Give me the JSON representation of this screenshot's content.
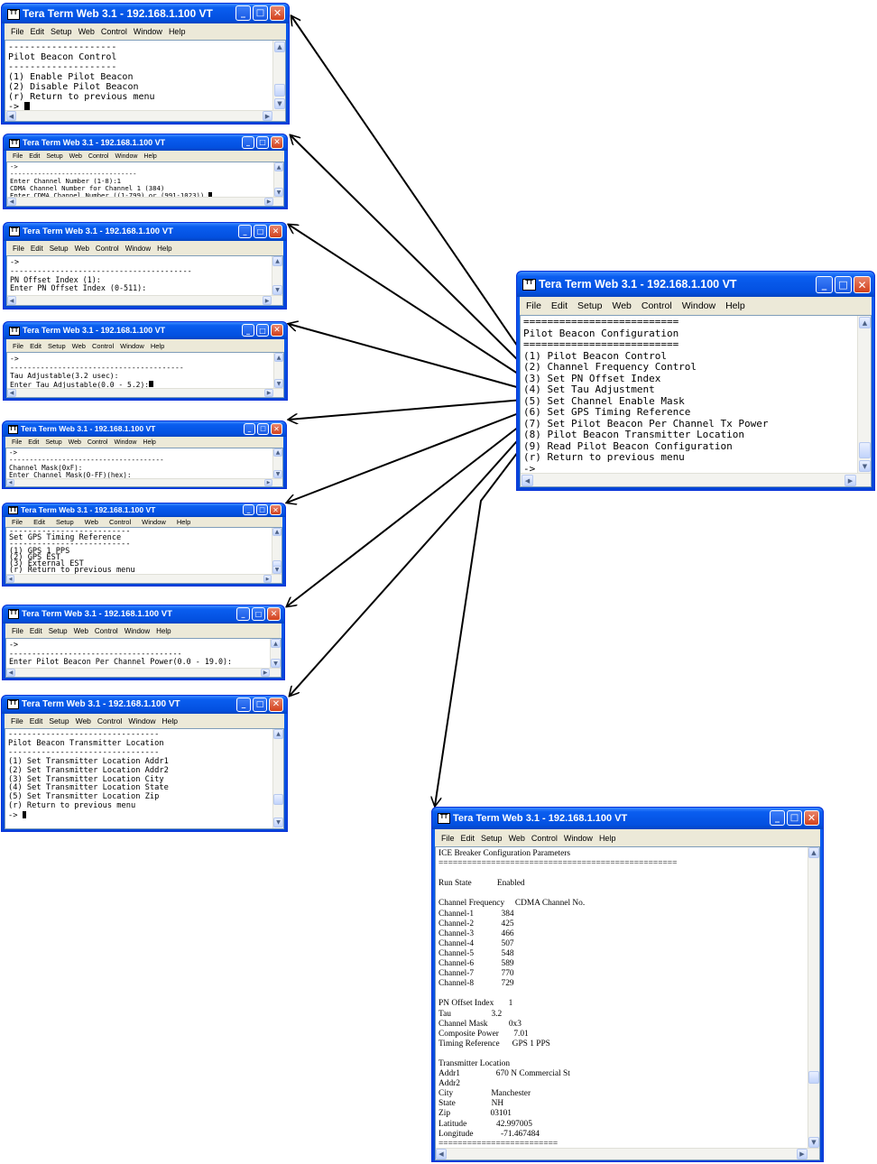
{
  "window_title": "Tera Term Web 3.1 - 192.168.1.100 VT",
  "menu": [
    "File",
    "Edit",
    "Setup",
    "Web",
    "Control",
    "Window",
    "Help"
  ],
  "windows": {
    "pilot_beacon_control": {
      "lines": "--------------------\nPilot Beacon Control\n--------------------\n(1) Enable Pilot Beacon\n(2) Disable Pilot Beacon\n(r) Return to previous menu\n-> "
    },
    "channel_frequency": {
      "lines": "->\n--------------------------------\nEnter Channel Number (1-8):1\nCDMA Channel Number for Channel 1 (384)\nEnter CDMA Channel Number ((1-799) or (991-1023)) "
    },
    "pn_offset": {
      "lines": "->\n----------------------------------------\nPN Offset Index (1):\nEnter PN Offset Index (0-511):"
    },
    "tau_adjustment": {
      "lines": "->\n----------------------------------------\nTau Adjustable(3.2 usec):\nEnter Tau Adjustable(0.0 - 5.2):"
    },
    "channel_mask": {
      "lines": "->\n--------------------------------------\nChannel Mask(0xF):\nEnter Channel Mask(0-FF)(hex):"
    },
    "gps_timing": {
      "lines": "--------------------------\nSet GPS Timing Reference\n--------------------------\n(1) GPS 1 PPS\n(2) GPS EST\n(3) External EST\n(r) Return to previous menu\n-> "
    },
    "tx_power": {
      "lines": "->\n--------------------------------------\nEnter Pilot Beacon Per Channel Power(0.0 - 19.0):"
    },
    "transmitter_location": {
      "lines": "--------------------------------\nPilot Beacon Transmitter Location\n--------------------------------\n(1) Set Transmitter Location Addr1\n(2) Set Transmitter Location Addr2\n(3) Set Transmitter Location City\n(4) Set Transmitter Location State\n(5) Set Transmitter Location Zip\n(r) Return to previous menu\n-> "
    },
    "main_menu": {
      "lines": "==========================\nPilot Beacon Configuration\n==========================\n(1) Pilot Beacon Control\n(2) Channel Frequency Control\n(3) Set PN Offset Index\n(4) Set Tau Adjustment\n(5) Set Channel Enable Mask\n(6) Set GPS Timing Reference\n(7) Set Pilot Beacon Per Channel Tx Power\n(8) Pilot Beacon Transmitter Location\n(9) Read Pilot Beacon Configuration\n(r) Return to previous menu\n->"
    },
    "config_params": {
      "lines": "ICE Breaker Configuration Parameters\n==================================================\n\nRun State            Enabled\n\nChannel Frequency     CDMA Channel No.\nChannel-1             384\nChannel-2             425\nChannel-3             466\nChannel-4             507\nChannel-5             548\nChannel-6             589\nChannel-7             770\nChannel-8             729\n\nPN Offset Index       1\nTau                   3.2\nChannel Mask          0x3\nComposite Power       7.01\nTiming Reference      GPS 1 PPS\n\nTransmitter Location\nAddr1                 670 N Commercial St\nAddr2\nCity                  Manchester\nState                 NH\nZip                   03101\nLatitude              42.997005\nLongitude             -71.467484\n========================="
    }
  }
}
